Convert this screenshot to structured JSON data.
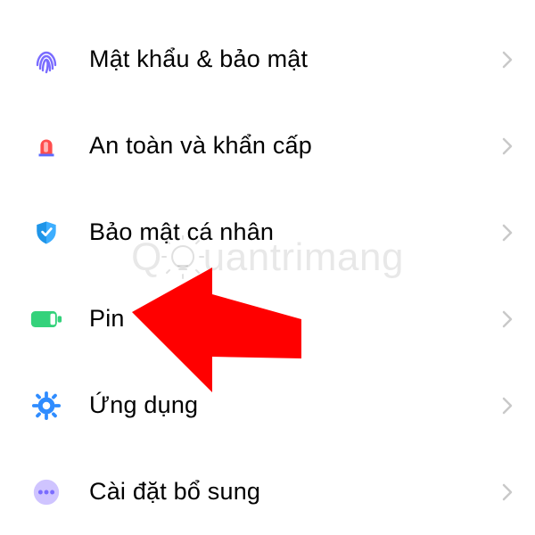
{
  "settings": {
    "items": [
      {
        "id": "password-security",
        "label": "Mật khẩu & bảo mật",
        "icon": "fingerprint-icon",
        "color": "#7a6cff"
      },
      {
        "id": "safety-emergency",
        "label": "An toàn và khẩn cấp",
        "icon": "siren-icon",
        "color": "#ff4d4d"
      },
      {
        "id": "privacy",
        "label": "Bảo mật cá nhân",
        "icon": "shield-icon",
        "color": "#3daeff"
      },
      {
        "id": "battery",
        "label": "Pin",
        "icon": "battery-icon",
        "color": "#34d27b"
      },
      {
        "id": "apps",
        "label": "Ứng dụng",
        "icon": "gear-icon",
        "color": "#2f8cff"
      },
      {
        "id": "additional",
        "label": "Cài đặt bổ sung",
        "icon": "more-icon",
        "color": "#b9a9ff"
      }
    ]
  },
  "watermark": {
    "prefix": "Q",
    "suffix": "uantrimang"
  },
  "annotation": {
    "arrow_points_to": "battery"
  }
}
